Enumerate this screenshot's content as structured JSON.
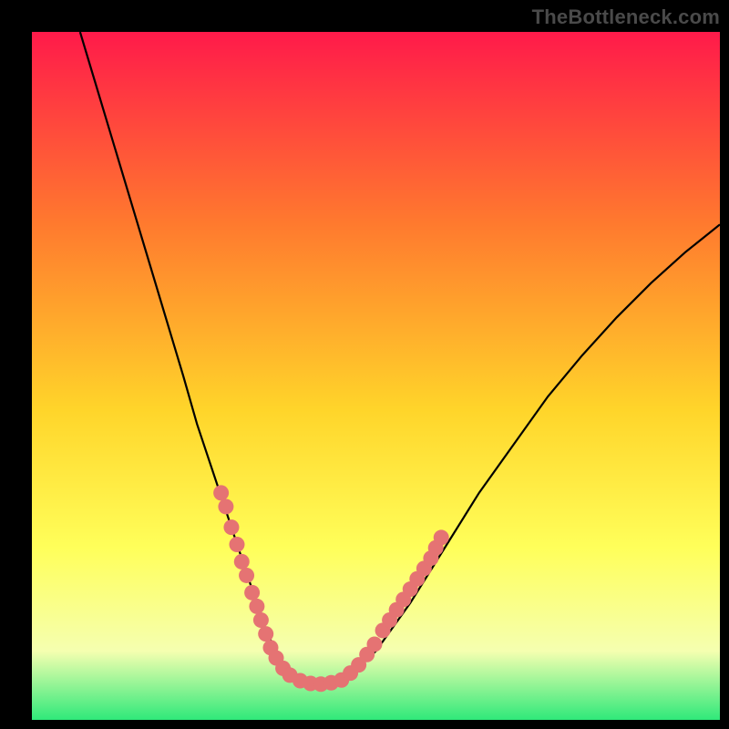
{
  "watermark": "TheBottleneck.com",
  "colors": {
    "bg": "#000000",
    "grad_top": "#ff1a4a",
    "grad_mid1": "#ff7a2e",
    "grad_mid2": "#ffd52a",
    "grad_mid3": "#ffff5a",
    "grad_low": "#f5ffb0",
    "grad_bottom": "#2fe97a",
    "curve": "#000000",
    "dot_fill": "#e57373",
    "dot_stroke": "#d45f5f"
  },
  "chart_data": {
    "type": "line",
    "title": "",
    "xlabel": "",
    "ylabel": "",
    "xlim": [
      0,
      100
    ],
    "ylim": [
      0,
      100
    ],
    "series": [
      {
        "name": "bottleneck-curve",
        "x": [
          7,
          10,
          13,
          16,
          19,
          22,
          24,
          26,
          28,
          30,
          31,
          32,
          33,
          34,
          35,
          36,
          37,
          38,
          40,
          42,
          45,
          50,
          55,
          60,
          65,
          70,
          75,
          80,
          85,
          90,
          95,
          100
        ],
        "y_pct_from_top": [
          0,
          10,
          20,
          30,
          40,
          50,
          57,
          63,
          69,
          75,
          78,
          81,
          84,
          87,
          89,
          91,
          92.5,
          93.5,
          94.5,
          94.8,
          94.5,
          90,
          83,
          75,
          67,
          60,
          53,
          47,
          41.5,
          36.5,
          32,
          28
        ]
      }
    ],
    "dots": [
      {
        "x": 27.5,
        "y_pct_from_top": 67
      },
      {
        "x": 28.2,
        "y_pct_from_top": 69
      },
      {
        "x": 29.0,
        "y_pct_from_top": 72
      },
      {
        "x": 29.8,
        "y_pct_from_top": 74.5
      },
      {
        "x": 30.5,
        "y_pct_from_top": 77
      },
      {
        "x": 31.2,
        "y_pct_from_top": 79
      },
      {
        "x": 32.0,
        "y_pct_from_top": 81.5
      },
      {
        "x": 32.7,
        "y_pct_from_top": 83.5
      },
      {
        "x": 33.3,
        "y_pct_from_top": 85.5
      },
      {
        "x": 34.0,
        "y_pct_from_top": 87.5
      },
      {
        "x": 34.7,
        "y_pct_from_top": 89.5
      },
      {
        "x": 35.5,
        "y_pct_from_top": 91
      },
      {
        "x": 36.5,
        "y_pct_from_top": 92.5
      },
      {
        "x": 37.5,
        "y_pct_from_top": 93.5
      },
      {
        "x": 39.0,
        "y_pct_from_top": 94.3
      },
      {
        "x": 40.5,
        "y_pct_from_top": 94.7
      },
      {
        "x": 42.0,
        "y_pct_from_top": 94.8
      },
      {
        "x": 43.5,
        "y_pct_from_top": 94.6
      },
      {
        "x": 45.0,
        "y_pct_from_top": 94.2
      },
      {
        "x": 46.3,
        "y_pct_from_top": 93.2
      },
      {
        "x": 47.5,
        "y_pct_from_top": 92
      },
      {
        "x": 48.7,
        "y_pct_from_top": 90.5
      },
      {
        "x": 49.8,
        "y_pct_from_top": 89
      },
      {
        "x": 51.0,
        "y_pct_from_top": 87
      },
      {
        "x": 52.0,
        "y_pct_from_top": 85.5
      },
      {
        "x": 53.0,
        "y_pct_from_top": 84
      },
      {
        "x": 54.0,
        "y_pct_from_top": 82.5
      },
      {
        "x": 55.0,
        "y_pct_from_top": 81
      },
      {
        "x": 56.0,
        "y_pct_from_top": 79.5
      },
      {
        "x": 57.0,
        "y_pct_from_top": 78
      },
      {
        "x": 58.0,
        "y_pct_from_top": 76.5
      },
      {
        "x": 58.7,
        "y_pct_from_top": 75
      },
      {
        "x": 59.5,
        "y_pct_from_top": 73.5
      }
    ],
    "gradient_stops_pct": [
      {
        "offset": 0,
        "key": "grad_top"
      },
      {
        "offset": 28,
        "key": "grad_mid1"
      },
      {
        "offset": 55,
        "key": "grad_mid2"
      },
      {
        "offset": 75,
        "key": "grad_mid3"
      },
      {
        "offset": 90,
        "key": "grad_low"
      },
      {
        "offset": 100,
        "key": "grad_bottom"
      }
    ]
  }
}
